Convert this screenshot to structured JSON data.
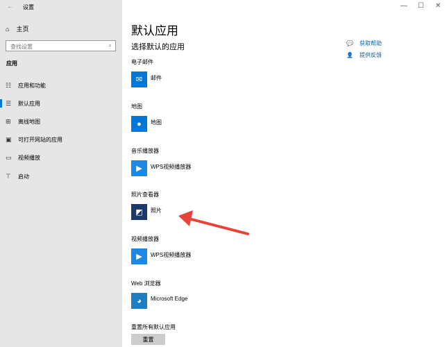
{
  "window": {
    "title": "设置",
    "controls": [
      "—",
      "☐",
      "✕"
    ]
  },
  "sidebar": {
    "home": "主页",
    "search_placeholder": "查找设置",
    "section": "应用",
    "items": [
      {
        "label": "应用和功能",
        "icon": "☷"
      },
      {
        "label": "默认应用",
        "icon": "☰"
      },
      {
        "label": "离线地图",
        "icon": "⊞"
      },
      {
        "label": "可打开网站的应用",
        "icon": "▣"
      },
      {
        "label": "视频播放",
        "icon": "▭"
      },
      {
        "label": "启动",
        "icon": "⊤"
      }
    ]
  },
  "main": {
    "title": "默认应用",
    "subtitle": "选择默认的应用",
    "help": "获取帮助",
    "feedback": "提供反馈",
    "categories": [
      {
        "label": "电子邮件",
        "app": "邮件",
        "icon": "✉",
        "color": "#0078d7"
      },
      {
        "label": "地图",
        "app": "地图",
        "icon": "●",
        "color": "#0078d7"
      },
      {
        "label": "音乐播放器",
        "app": "WPS视频播放器",
        "icon": "▶",
        "color": "#1e88e5"
      },
      {
        "label": "照片查看器",
        "app": "照片",
        "icon": "◩",
        "color": "#1b3a6b"
      },
      {
        "label": "视频播放器",
        "app": "WPS视频播放器",
        "icon": "▶",
        "color": "#1e88e5"
      },
      {
        "label": "Web 浏览器",
        "app": "Microsoft Edge",
        "icon": "◕",
        "color": "#1c7fc4"
      }
    ],
    "reset_label": "重置所有默认应用",
    "reset_button": "重置"
  },
  "colors": {
    "accent": "#0078d7",
    "arrow": "#e8423a"
  }
}
